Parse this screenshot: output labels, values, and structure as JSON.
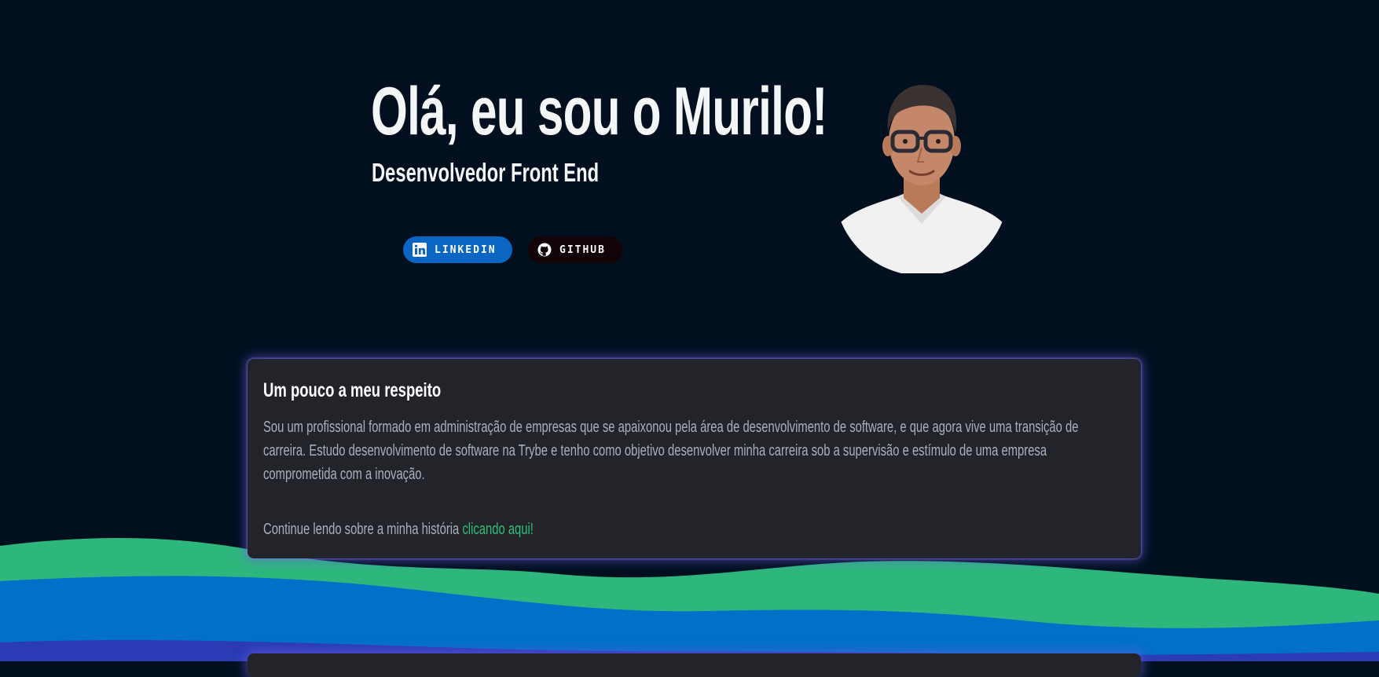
{
  "hero": {
    "title": "Olá, eu sou o Murilo!",
    "subtitle": "Desenvolvedor Front End",
    "buttons": {
      "linkedin": {
        "label": "LINKEDIN",
        "icon": "linkedin-icon",
        "color": "#0a66c2"
      },
      "github": {
        "label": "GITHUB",
        "icon": "github-icon",
        "color": "#120307"
      }
    },
    "avatar_alt": "Murilo"
  },
  "about": {
    "title": "Um pouco a meu respeito",
    "paragraph": "Sou um profissional formado em administração de empresas que se apaixonou pela área de desenvolvimento de software, e que agora vive uma transição de carreira. Estudo desenvolvimento de software na Trybe e tenho como objetivo desenvolver minha carreira sob a supervisão e estímulo de uma empresa comprometida com a inovação.",
    "more_prefix": "Continue lendo sobre a minha história ",
    "more_link": "clicando aqui!"
  },
  "colors": {
    "background": "#010f1f",
    "card": "#232429",
    "card_glow": "#705ce6",
    "link_green": "#2fbf7a",
    "wave_green": "#2db77d",
    "wave_blue": "#0070c8",
    "wave_indigo": "#2b3bb5"
  }
}
